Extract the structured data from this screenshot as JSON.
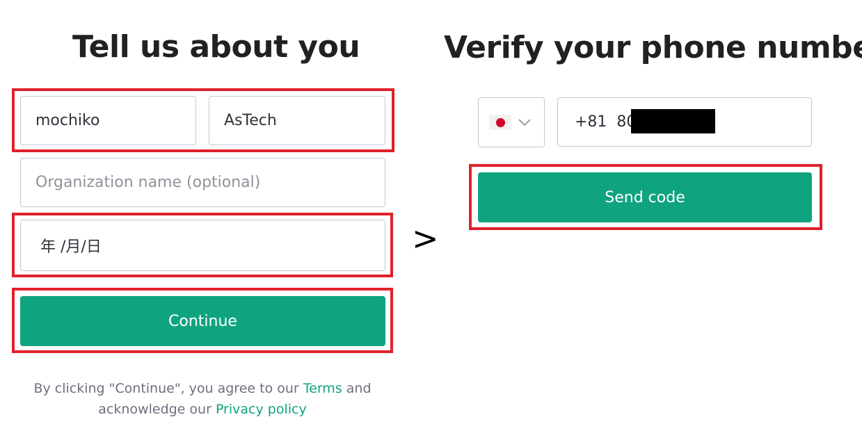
{
  "left": {
    "title": "Tell us about you",
    "first_name_value": "mochiko",
    "last_name_value": "AsTech",
    "organization_placeholder": "Organization name (optional)",
    "birthday_value": "年 /月/日",
    "continue_label": "Continue",
    "legal": {
      "before_terms": "By clicking \"Continue\", you agree to our ",
      "terms_link": "Terms",
      "after_terms": " and",
      "before_privacy": "acknowledge our ",
      "privacy_link": "Privacy policy"
    }
  },
  "arrow": ">",
  "right": {
    "title": "Verify your phone number",
    "country_flag": "japan-flag-icon",
    "phone_value": "+81  80",
    "send_code_label": "Send code"
  },
  "colors": {
    "accent": "#10a37f",
    "highlight": "#e0212b",
    "text": "#202123"
  }
}
